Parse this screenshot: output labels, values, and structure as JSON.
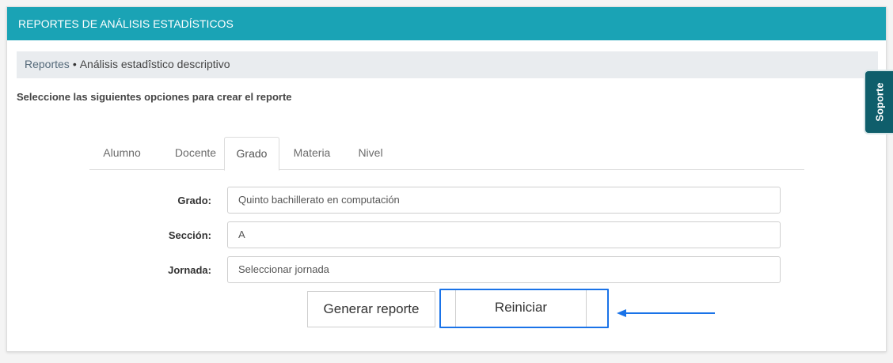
{
  "header": {
    "title": "REPORTES DE ANÁLISIS ESTADÍSTICOS"
  },
  "breadcrumb": {
    "link": "Reportes",
    "separator": "•",
    "current": "Análisis estadîstico descriptivo"
  },
  "instruction": "Seleccione las siguientes opciones para crear el reporte",
  "tabs": [
    {
      "label": "Alumno"
    },
    {
      "label": "Docente"
    },
    {
      "label": "Grado"
    },
    {
      "label": "Materia"
    },
    {
      "label": "Nivel"
    }
  ],
  "active_tab": "Grado",
  "form": {
    "grado": {
      "label": "Grado:",
      "value": "Quinto bachillerato en computación"
    },
    "seccion": {
      "label": "Sección:",
      "value": "A"
    },
    "jornada": {
      "label": "Jornada:",
      "value": "Seleccionar jornada"
    }
  },
  "buttons": {
    "generate": "Generar reporte",
    "reset": "Reiniciar"
  },
  "support": {
    "label": "Soporte"
  },
  "colors": {
    "header": "#1aa3b5",
    "support": "#0f5e6b",
    "highlight": "#1a73e8"
  }
}
